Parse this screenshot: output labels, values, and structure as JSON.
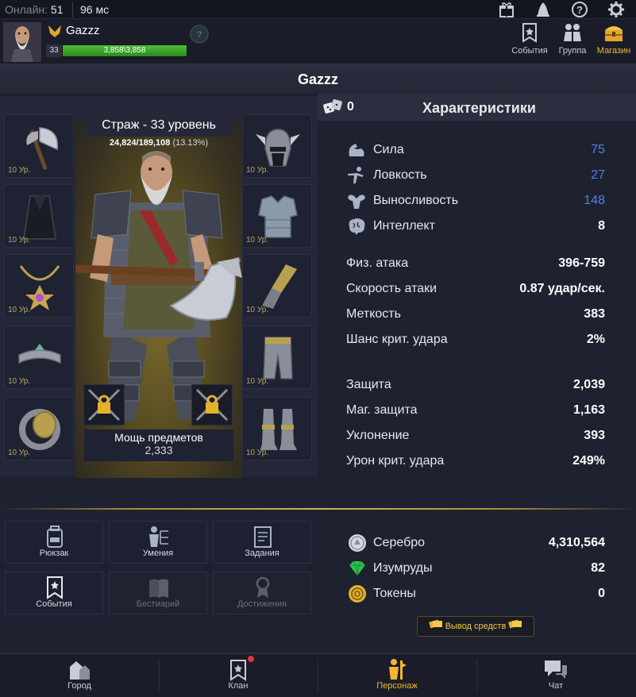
{
  "topbar": {
    "online_label": "Онлайн:",
    "online_count": "51",
    "ping": "96 мс",
    "icons": [
      "gift-icon",
      "bell-icon",
      "help-icon",
      "settings-icon"
    ]
  },
  "header": {
    "name": "Gazzz",
    "level": "33",
    "hp_text": "3,858\\3,858",
    "hp_fraction": 1.0,
    "nav": [
      {
        "label": "События",
        "icon": "banner-icon"
      },
      {
        "label": "Группа",
        "icon": "group-icon"
      },
      {
        "label": "Магазин",
        "icon": "chest-icon",
        "active": true
      }
    ]
  },
  "title": "Gazzz",
  "character": {
    "class_level": "Страж - 33 уровень",
    "xp_current": "24,824/189,108",
    "xp_percent": "(13.13%)",
    "power_label": "Мощь предметов",
    "power_value": "2,333",
    "slot_level": "10 Ур.",
    "left_slots": [
      "axe-icon",
      "cloak-icon",
      "necklace-icon",
      "bracer-icon",
      "ring-icon"
    ],
    "right_slots": [
      "helmet-icon",
      "chest-armor-icon",
      "glove-icon",
      "leggings-icon",
      "boots-icon"
    ]
  },
  "stats": {
    "points": "0",
    "title": "Характеристики",
    "primary": [
      {
        "label": "Сила",
        "value": "75",
        "icon": "muscle-icon"
      },
      {
        "label": "Ловкость",
        "value": "27",
        "icon": "acrobat-icon"
      },
      {
        "label": "Выносливость",
        "value": "148",
        "icon": "heart-muscle-icon"
      },
      {
        "label": "Интеллект",
        "value": "8",
        "icon": "brain-icon"
      }
    ],
    "attack": [
      {
        "label": "Физ. атака",
        "value": "396-759"
      },
      {
        "label": "Скорость атаки",
        "value": "0.87 удар/сек."
      },
      {
        "label": "Меткость",
        "value": "383"
      },
      {
        "label": "Шанс крит. удара",
        "value": "2%"
      }
    ],
    "defense": [
      {
        "label": "Защита",
        "value": "2,039"
      },
      {
        "label": "Маг. защита",
        "value": "1,163"
      },
      {
        "label": "Уклонение",
        "value": "393"
      },
      {
        "label": "Урон крит. удара",
        "value": "249%"
      }
    ]
  },
  "actions": [
    {
      "label": "Рюкзак",
      "icon": "backpack-icon"
    },
    {
      "label": "Умения",
      "icon": "skills-icon"
    },
    {
      "label": "Задания",
      "icon": "quests-icon"
    },
    {
      "label": "События",
      "icon": "banner-icon"
    },
    {
      "label": "Бестиарий",
      "icon": "book-icon",
      "disabled": true
    },
    {
      "label": "Достижения",
      "icon": "medal-icon",
      "disabled": true
    }
  ],
  "currencies": [
    {
      "label": "Серебро",
      "value": "4,310,564",
      "icon": "silver-coin-icon"
    },
    {
      "label": "Изумруды",
      "value": "82",
      "icon": "emerald-icon"
    },
    {
      "label": "Токены",
      "value": "0",
      "icon": "token-icon"
    }
  ],
  "withdraw_label": "Вывод средств",
  "bottom_nav": [
    {
      "label": "Город",
      "icon": "town-icon"
    },
    {
      "label": "Клан",
      "icon": "clan-icon"
    },
    {
      "label": "Персонаж",
      "icon": "character-icon",
      "active": true
    },
    {
      "label": "Чат",
      "icon": "chat-icon"
    }
  ],
  "colors": {
    "accent": "#f2b632",
    "stat_blue": "#4b84e0",
    "hp_green": "#3fae2e",
    "bg": "#1e2130"
  }
}
